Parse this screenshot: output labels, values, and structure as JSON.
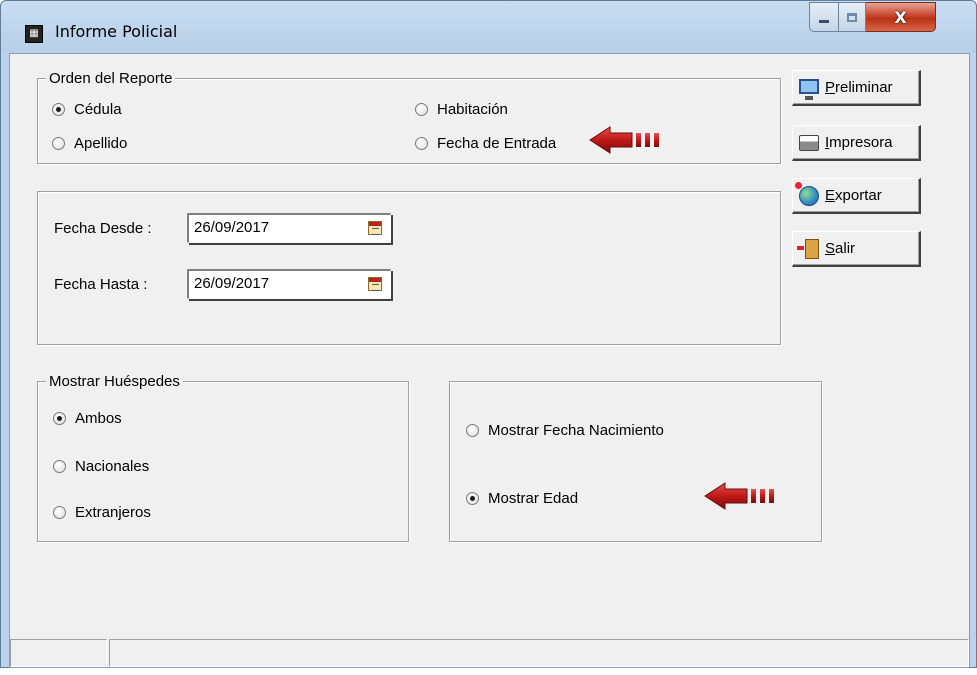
{
  "window": {
    "title": "Informe Policial",
    "close_glyph": "X"
  },
  "orden": {
    "legend": "Orden del Reporte",
    "options": [
      {
        "label": "Cédula",
        "checked": true
      },
      {
        "label": "Apellido",
        "checked": false
      },
      {
        "label": "Habitación",
        "checked": false
      },
      {
        "label": "Fecha de Entrada",
        "checked": false
      }
    ]
  },
  "fechas": {
    "desde_label": "Fecha Desde :",
    "desde_value": "26/09/2017",
    "hasta_label": "Fecha Hasta :",
    "hasta_value": "26/09/2017"
  },
  "huespedes": {
    "legend": "Mostrar Huéspedes",
    "options": [
      {
        "label": "Ambos",
        "checked": true
      },
      {
        "label": "Nacionales",
        "checked": false
      },
      {
        "label": "Extranjeros",
        "checked": false
      }
    ]
  },
  "mostrar": {
    "options": [
      {
        "label": "Mostrar Fecha Nacimiento",
        "checked": false
      },
      {
        "label": "Mostrar Edad",
        "checked": true
      }
    ]
  },
  "buttons": [
    {
      "mnemonic": "P",
      "rest": "reliminar",
      "icon": "monitor-icon"
    },
    {
      "mnemonic": "I",
      "rest": "mpresora",
      "icon": "printer-icon"
    },
    {
      "mnemonic": "E",
      "rest": "xportar",
      "icon": "globe-icon"
    },
    {
      "mnemonic": "S",
      "rest": "alir",
      "icon": "exit-door-icon"
    }
  ],
  "colors": {
    "arrow": "#c01818",
    "close_button": "#c8452e"
  }
}
